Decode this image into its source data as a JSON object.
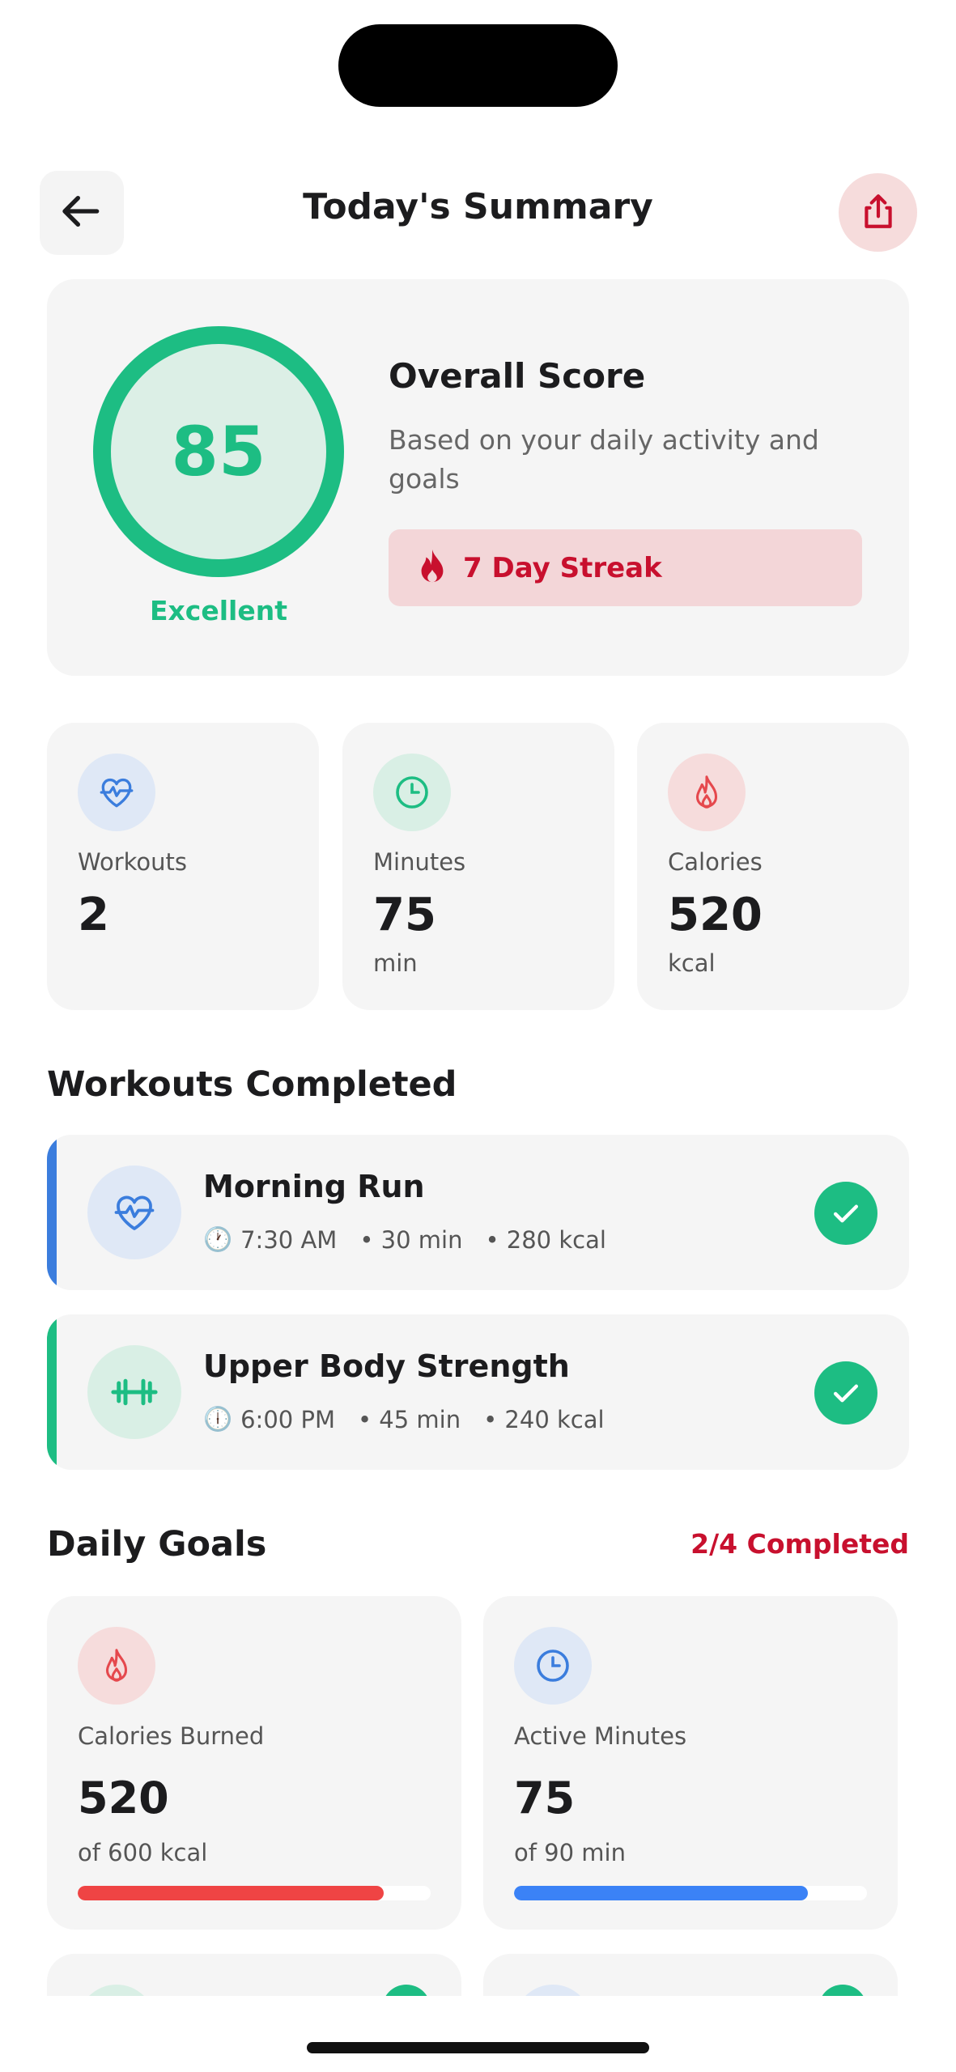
{
  "header": {
    "title": "Today's Summary"
  },
  "score": {
    "value": "85",
    "rating": "Excellent",
    "title": "Overall Score",
    "description": "Based on your daily activity and goals",
    "streak": "7 Day Streak"
  },
  "stats": [
    {
      "label": "Workouts",
      "value": "2",
      "unit": "",
      "icon": "heart-pulse-icon",
      "color": "#3b7ddd"
    },
    {
      "label": "Minutes",
      "value": "75",
      "unit": "min",
      "icon": "clock-icon",
      "color": "#1dbd83"
    },
    {
      "label": "Calories",
      "value": "520",
      "unit": "kcal",
      "icon": "flame-icon",
      "color": "#e5484d"
    }
  ],
  "workouts": {
    "title": "Workouts Completed",
    "items": [
      {
        "name": "Morning Run",
        "time": "7:30 AM",
        "duration": "• 30 min",
        "calories": "• 280 kcal",
        "icon": "heart-pulse-icon",
        "accent": "#3b7ddd"
      },
      {
        "name": "Upper Body Strength",
        "time": "6:00 PM",
        "duration": "• 45 min",
        "calories": "• 240 kcal",
        "icon": "dumbbell-icon",
        "accent": "#1dbd83"
      }
    ]
  },
  "goals": {
    "title": "Daily Goals",
    "status": "2/4 Completed",
    "items": [
      {
        "label": "Calories Burned",
        "value": "520",
        "target": "of 600 kcal",
        "progress": 0.867,
        "color": "#ef4444",
        "icon": "flame-icon"
      },
      {
        "label": "Active Minutes",
        "value": "75",
        "target": "of 90 min",
        "progress": 0.833,
        "color": "#3b82f6",
        "icon": "clock-icon"
      }
    ]
  },
  "colors": {
    "accent_green": "#1dbd83",
    "accent_red": "#c8102e",
    "accent_blue": "#3b7ddd"
  }
}
